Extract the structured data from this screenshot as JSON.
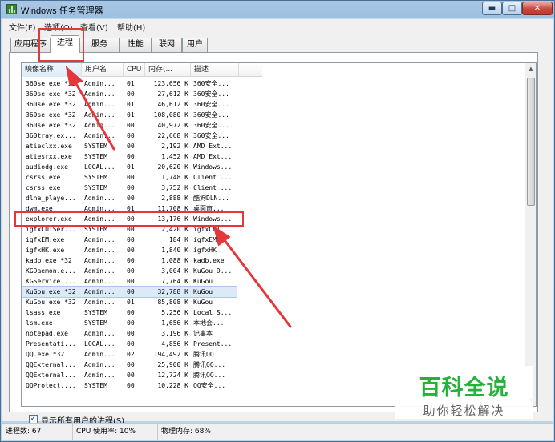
{
  "window": {
    "title": "Windows 任务管理器",
    "min_glyph": "▬",
    "max_glyph": "□",
    "close_glyph": "✕"
  },
  "menu": [
    {
      "label": "文件(F)"
    },
    {
      "label": "选项(O)"
    },
    {
      "label": "查看(V)"
    },
    {
      "label": "帮助(H)"
    }
  ],
  "tabs": [
    {
      "label": "应用程序",
      "active": false
    },
    {
      "label": "进程",
      "active": true
    },
    {
      "label": "服务",
      "active": false
    },
    {
      "label": "性能",
      "active": false
    },
    {
      "label": "联网",
      "active": false
    },
    {
      "label": "用户",
      "active": false
    }
  ],
  "columns": {
    "name": "映像名称",
    "user": "用户名",
    "cpu": "CPU",
    "mem": "内存(...",
    "desc": "描述"
  },
  "processes": [
    {
      "name": "360se.exe *32",
      "user": "Admin...",
      "cpu": "01",
      "mem": "123,656 K",
      "desc": "360安全..."
    },
    {
      "name": "360se.exe *32",
      "user": "Admin...",
      "cpu": "00",
      "mem": "27,612 K",
      "desc": "360安全..."
    },
    {
      "name": "360se.exe *32",
      "user": "Admin...",
      "cpu": "01",
      "mem": "46,612 K",
      "desc": "360安全..."
    },
    {
      "name": "360se.exe *32",
      "user": "Admin...",
      "cpu": "01",
      "mem": "108,080 K",
      "desc": "360安全..."
    },
    {
      "name": "360se.exe *32",
      "user": "Admin...",
      "cpu": "00",
      "mem": "40,972 K",
      "desc": "360安全..."
    },
    {
      "name": "360tray.ex...",
      "user": "Admin...",
      "cpu": "00",
      "mem": "22,668 K",
      "desc": "360安全..."
    },
    {
      "name": "atieclxx.exe",
      "user": "SYSTEM",
      "cpu": "00",
      "mem": "2,192 K",
      "desc": "AMD Ext..."
    },
    {
      "name": "atiesrxx.exe",
      "user": "SYSTEM",
      "cpu": "00",
      "mem": "1,452 K",
      "desc": "AMD Ext..."
    },
    {
      "name": "audiodg.exe",
      "user": "LOCAL...",
      "cpu": "01",
      "mem": "20,620 K",
      "desc": "Windows..."
    },
    {
      "name": "csrss.exe",
      "user": "SYSTEM",
      "cpu": "00",
      "mem": "1,748 K",
      "desc": "Client ..."
    },
    {
      "name": "csrss.exe",
      "user": "SYSTEM",
      "cpu": "00",
      "mem": "3,752 K",
      "desc": "Client ..."
    },
    {
      "name": "dlna_playe...",
      "user": "Admin...",
      "cpu": "00",
      "mem": "2,888 K",
      "desc": "酷狗DLN..."
    },
    {
      "name": "dwm.exe",
      "user": "Admin...",
      "cpu": "01",
      "mem": "11,708 K",
      "desc": "桌面窗..."
    },
    {
      "name": "explorer.exe",
      "user": "Admin...",
      "cpu": "00",
      "mem": "13,176 K",
      "desc": "Windows..."
    },
    {
      "name": "igfxCUISer...",
      "user": "SYSTEM",
      "cpu": "00",
      "mem": "2,420 K",
      "desc": "igfxCUI..."
    },
    {
      "name": "igfxEM.exe",
      "user": "Admin...",
      "cpu": "00",
      "mem": "184 K",
      "desc": "igfxEM"
    },
    {
      "name": "igfxHK.exe",
      "user": "Admin...",
      "cpu": "00",
      "mem": "1,840 K",
      "desc": "igfxHK"
    },
    {
      "name": "kadb.exe *32",
      "user": "Admin...",
      "cpu": "00",
      "mem": "1,088 K",
      "desc": "kadb.exe"
    },
    {
      "name": "KGDaemon.e...",
      "user": "Admin...",
      "cpu": "00",
      "mem": "3,004 K",
      "desc": "KuGou D..."
    },
    {
      "name": "KGService....",
      "user": "Admin...",
      "cpu": "00",
      "mem": "7,764 K",
      "desc": "KuGou"
    },
    {
      "name": "KuGou.exe *32",
      "user": "Admin...",
      "cpu": "00",
      "mem": "32,788 K",
      "desc": "KuGou"
    },
    {
      "name": "KuGou.exe *32",
      "user": "Admin...",
      "cpu": "01",
      "mem": "85,808 K",
      "desc": "KuGou"
    },
    {
      "name": "lsass.exe",
      "user": "SYSTEM",
      "cpu": "00",
      "mem": "5,256 K",
      "desc": "Local S..."
    },
    {
      "name": "lsm.exe",
      "user": "SYSTEM",
      "cpu": "00",
      "mem": "1,656 K",
      "desc": "本地会..."
    },
    {
      "name": "notepad.exe",
      "user": "Admin...",
      "cpu": "00",
      "mem": "3,196 K",
      "desc": "记事本"
    },
    {
      "name": "Presentati...",
      "user": "LOCAL...",
      "cpu": "00",
      "mem": "4,856 K",
      "desc": "Present..."
    },
    {
      "name": "QQ.exe *32",
      "user": "Admin...",
      "cpu": "02",
      "mem": "194,492 K",
      "desc": "腾讯QQ"
    },
    {
      "name": "QQExternal...",
      "user": "Admin...",
      "cpu": "00",
      "mem": "25,900 K",
      "desc": "腾讯QQ..."
    },
    {
      "name": "QQExternal...",
      "user": "Admin...",
      "cpu": "00",
      "mem": "12,724 K",
      "desc": "腾讯QQ..."
    },
    {
      "name": "QQProtect....",
      "user": "SYSTEM",
      "cpu": "00",
      "mem": "10,228 K",
      "desc": "QQ安全..."
    }
  ],
  "selected_row_index": 20,
  "show_all_label": "显示所有用户的进程(S)",
  "show_all_checked": true,
  "status": {
    "processes": "进程数: 67",
    "cpu": "CPU 使用率: 10%",
    "memory": "物理内存: 68%"
  },
  "watermark": {
    "main": "百科全说",
    "sub": "助你轻松解决"
  },
  "colors": {
    "annotation": "#e5363a",
    "watermark_green": "#24b23a"
  }
}
